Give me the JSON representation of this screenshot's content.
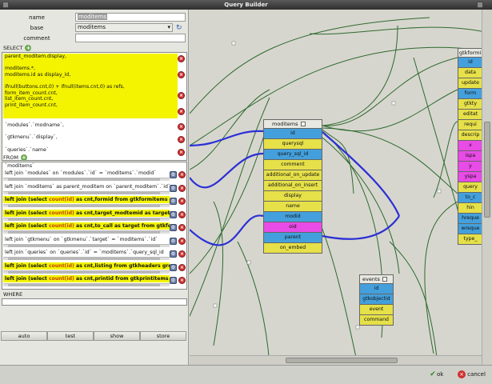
{
  "window": {
    "title": "Query Builder"
  },
  "form": {
    "name_label": "name",
    "name_value": "moditems",
    "base_label": "base",
    "base_value": "moditems",
    "comment_label": "comment",
    "comment_value": ""
  },
  "select": {
    "label": "SELECT",
    "items": [
      "parent_moditem.display,\n\nmoditems.*,\nmoditems.id as display_id,\n\nifnull(buttons.cnt,0) + ifnull(items.cnt,0) as refs,\nform_item_count.cnt,\nlist_item_count.cnt,\nprint_item_count.cnt,",
      "`modules`.`modname`,",
      "`gtkmenu`.`display`,",
      "`queries`.`name`"
    ]
  },
  "from": {
    "label": "FROM",
    "base": "`moditems`",
    "items": [
      {
        "pre": "left join `modules` on `modules`.`id` = `moditems`.`modid`",
        "cnt": "",
        "post": "",
        "hl": false
      },
      {
        "pre": "left join `moditems` as parent_moditem on `parent_moditem`.`id`",
        "cnt": "",
        "post": "",
        "hl": false
      },
      {
        "pre": "left join (select ",
        "cnt": "count(id)",
        "post": " as cnt,formid from gtkformitems group",
        "hl": true
      },
      {
        "pre": "left join (select ",
        "cnt": "count(id)",
        "post": " as cnt,target_modtemid as target from",
        "hl": true
      },
      {
        "pre": "left join (select ",
        "cnt": "count(id)",
        "post": " as cnt,to_call as target from gtkformite",
        "hl": true
      },
      {
        "pre": "left join `gtkmenu` on `gtkmenu`.`target` = `moditems`.`id`",
        "cnt": "",
        "post": "",
        "hl": false
      },
      {
        "pre": "left join `queries` on `queries`.`id` = `moditems`.`query_sql_id",
        "cnt": "",
        "post": "",
        "hl": false
      },
      {
        "pre": "left join (select ",
        "cnt": "count(id)",
        "post": " as cnt,listing from gtkheaders group b",
        "hl": true
      },
      {
        "pre": "left join (select ",
        "cnt": "count(id)",
        "post": " as cnt,printid from gtkprintitems group",
        "hl": true
      }
    ]
  },
  "where": {
    "label": "WHERE",
    "value": ""
  },
  "buttons": {
    "auto": "auto",
    "test": "test",
    "show": "show",
    "store": "store"
  },
  "footer": {
    "ok": "ok",
    "cancel": "cancel"
  },
  "tables": {
    "moditems": {
      "name": "moditems",
      "fields": [
        {
          "name": "id",
          "color": "#44a0dc"
        },
        {
          "name": "querysql",
          "color": "#e6e049"
        },
        {
          "name": "query_sql_id",
          "color": "#44a0dc"
        },
        {
          "name": "comment",
          "color": "#e6e049"
        },
        {
          "name": "additional_on_update",
          "color": "#e6e049"
        },
        {
          "name": "additional_on_insert",
          "color": "#e6e049"
        },
        {
          "name": "display",
          "color": "#e6e049"
        },
        {
          "name": "name",
          "color": "#e6e049"
        },
        {
          "name": "modid",
          "color": "#44a0dc"
        },
        {
          "name": "oid",
          "color": "#e84be6"
        },
        {
          "name": "parent",
          "color": "#44a0dc"
        },
        {
          "name": "on_embed",
          "color": "#e6e049"
        }
      ]
    },
    "events": {
      "name": "events",
      "fields": [
        {
          "name": "id",
          "color": "#44a0dc"
        },
        {
          "name": "gtkobjectid",
          "color": "#44a0dc"
        },
        {
          "name": "event",
          "color": "#e6e049"
        },
        {
          "name": "command",
          "color": "#e6e049"
        }
      ]
    },
    "gtkformitems": {
      "name": "gtkformite",
      "fields": [
        {
          "name": "id",
          "color": "#44a0dc"
        },
        {
          "name": "data",
          "color": "#e6e049"
        },
        {
          "name": "update",
          "color": "#e6e049"
        },
        {
          "name": "form",
          "color": "#44a0dc"
        },
        {
          "name": "gtkty",
          "color": "#e6e049"
        },
        {
          "name": "editat",
          "color": "#e6e049"
        },
        {
          "name": "requi",
          "color": "#e6e049"
        },
        {
          "name": "descrip",
          "color": "#e6e049"
        },
        {
          "name": "x",
          "color": "#e84be6"
        },
        {
          "name": "ispa",
          "color": "#e84be6"
        },
        {
          "name": "y",
          "color": "#e84be6"
        },
        {
          "name": "yspa",
          "color": "#e84be6"
        },
        {
          "name": "query",
          "color": "#e6e049"
        },
        {
          "name": "to_c",
          "color": "#44a0dc"
        },
        {
          "name": "hin",
          "color": "#e6e049"
        },
        {
          "name": "hreque",
          "color": "#44a0dc"
        },
        {
          "name": "wreque",
          "color": "#44a0dc"
        },
        {
          "name": "type_",
          "color": "#e6e049"
        }
      ]
    }
  },
  "colors": {
    "link_blue": "#2b2fd6",
    "link_green": "#2f6a2f",
    "key": "#44a0dc",
    "field": "#e6e049",
    "oid": "#e84be6"
  }
}
